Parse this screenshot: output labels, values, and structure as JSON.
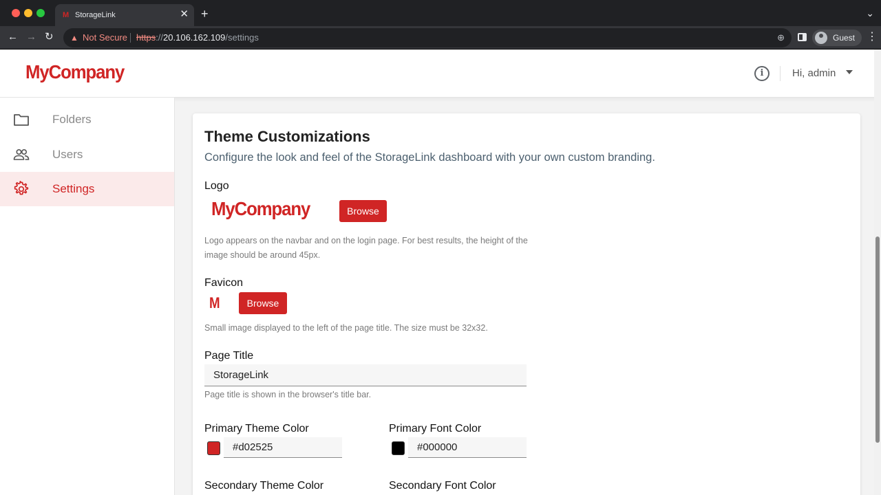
{
  "browser": {
    "tab_title": "StorageLink",
    "tab_favicon": "M",
    "security_label": "Not Secure",
    "url_scheme": "https",
    "url_sep": "://",
    "url_host": "20.106.162.109",
    "url_path": "/settings",
    "profile_name": "Guest"
  },
  "header": {
    "logo_text": "MyCompany",
    "user_greeting": "Hi, admin"
  },
  "sidebar": {
    "items": [
      {
        "label": "Folders",
        "icon": "folder-icon",
        "active": false
      },
      {
        "label": "Users",
        "icon": "users-icon",
        "active": false
      },
      {
        "label": "Settings",
        "icon": "gear-icon",
        "active": true
      }
    ]
  },
  "theme": {
    "title": "Theme Customizations",
    "subtitle": "Configure the look and feel of the StorageLink dashboard with your own custom branding.",
    "logo": {
      "label": "Logo",
      "preview_text": "MyCompany",
      "browse_label": "Browse",
      "help": "Logo appears on the navbar and on the login page. For best results, the height of the image should be around 45px."
    },
    "favicon": {
      "label": "Favicon",
      "preview_text": "M",
      "browse_label": "Browse",
      "help": "Small image displayed to the left of the page title. The size must be 32x32."
    },
    "page_title": {
      "label": "Page Title",
      "value": "StorageLink",
      "help": "Page title is shown in the browser's title bar."
    },
    "primary_theme_color": {
      "label": "Primary Theme Color",
      "value": "#d02525"
    },
    "primary_font_color": {
      "label": "Primary Font Color",
      "value": "#000000"
    },
    "secondary_theme_color": {
      "label": "Secondary Theme Color"
    },
    "secondary_font_color": {
      "label": "Secondary Font Color"
    }
  },
  "colors": {
    "brand": "#d02525",
    "active_bg": "#fbeaea"
  }
}
